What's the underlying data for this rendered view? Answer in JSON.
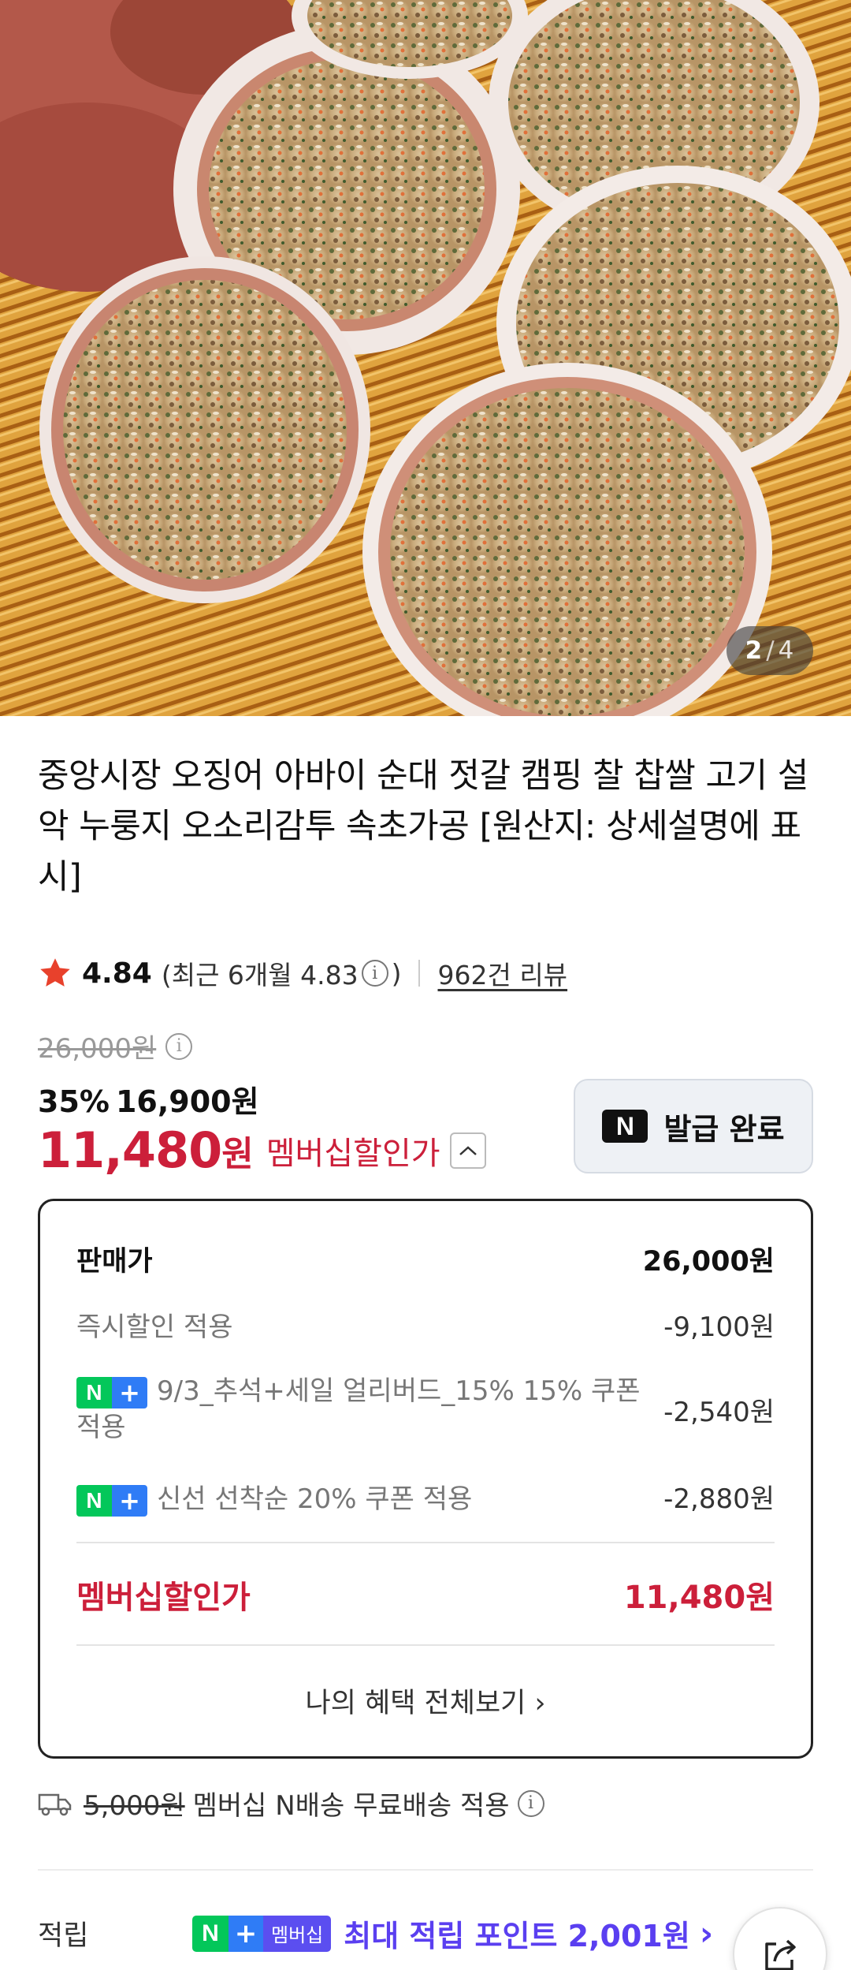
{
  "gallery": {
    "current": "2",
    "separator": "/",
    "total": "4"
  },
  "product": {
    "title": "중앙시장 오징어 아바이 순대 젓갈 캠핑 찰 찹쌀 고기 설악 누룽지 오소리감투 속초가공 [원산지: 상세설명에 표시]"
  },
  "rating": {
    "score": "4.84",
    "recent_prefix": "(최근 6개월 4.83",
    "recent_suffix": ")",
    "review_link": "962건 리뷰"
  },
  "price": {
    "original": "26,000원",
    "discount_percent": "35%",
    "sale_price": "16,900원",
    "membership_amount": "11,480",
    "membership_won": "원",
    "membership_label": "멤버십할인가"
  },
  "coupon_button": {
    "logo": "N",
    "label": "발급 완료"
  },
  "breakdown": {
    "sell_price_label": "판매가",
    "sell_price_value": "26,000원",
    "items": [
      {
        "label": "즉시할인 적용",
        "value": "-9,100원"
      },
      {
        "label": "9/3_추석+세일 얼리버드_15% 15% 쿠폰 적용",
        "value": "-2,540원"
      },
      {
        "label": "신선 선착순 20% 쿠폰 적용",
        "value": "-2,880원"
      }
    ],
    "total_label": "멤버십할인가",
    "total_value": "11,480원",
    "view_all": "나의 혜택 전체보기 ›"
  },
  "badges": {
    "n": "N",
    "plus": "+",
    "membership": "멤버십"
  },
  "shipping": {
    "old_fee": "5,000원",
    "text": "멤버십 N배송 무료배송 적용"
  },
  "points": {
    "label": "적립",
    "text": "최대 적립 포인트 2,001원",
    "arrow": "›"
  },
  "colors": {
    "accent_red": "#cc1f3a",
    "naver_green": "#03c75a",
    "naver_blue": "#2f7cf6",
    "points_purple": "#5a3ff0"
  },
  "icons": [
    "star-icon",
    "info-icon",
    "chevron-up-icon",
    "truck-icon",
    "share-icon"
  ]
}
